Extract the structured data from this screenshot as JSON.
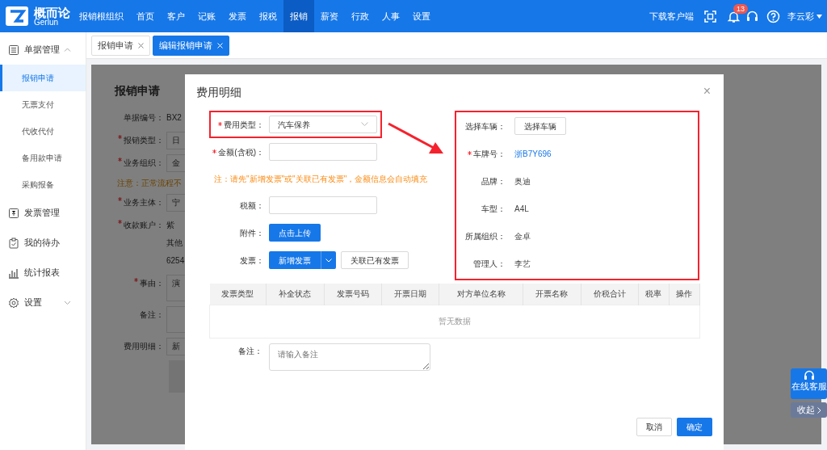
{
  "header": {
    "logo_text": "概而论",
    "logo_subtext": "Gerlun",
    "nav": [
      {
        "label": "报销根组织",
        "selected": false
      },
      {
        "label": "首页",
        "selected": false
      },
      {
        "label": "客户",
        "selected": false
      },
      {
        "label": "记账",
        "selected": false
      },
      {
        "label": "发票",
        "selected": false
      },
      {
        "label": "报税",
        "selected": false
      },
      {
        "label": "报销",
        "selected": true
      },
      {
        "label": "薪资",
        "selected": false
      },
      {
        "label": "行政",
        "selected": false
      },
      {
        "label": "人事",
        "selected": false
      },
      {
        "label": "设置",
        "selected": false
      }
    ],
    "download": "下载客户端",
    "notification_count": "13",
    "user": "李云彩"
  },
  "sidebar": {
    "items": [
      {
        "label": "单据管理",
        "expanded": true,
        "children": [
          {
            "label": "报销申请",
            "selected": true
          },
          {
            "label": "无票支付",
            "selected": false
          },
          {
            "label": "代收代付",
            "selected": false
          },
          {
            "label": "备用款申请",
            "selected": false
          },
          {
            "label": "采购报备",
            "selected": false
          }
        ]
      },
      {
        "label": "发票管理"
      },
      {
        "label": "我的待办"
      },
      {
        "label": "统计报表"
      },
      {
        "label": "设置",
        "expanded": false
      }
    ]
  },
  "tabs": [
    {
      "label": "报销申请",
      "selected": false
    },
    {
      "label": "编辑报销申请",
      "selected": true
    }
  ],
  "background_form": {
    "title": "报销申请",
    "fields": [
      {
        "kind": "text",
        "label": "单据编号：",
        "required": false,
        "values": [
          "BX2"
        ]
      },
      {
        "kind": "input",
        "label": "报销类型：",
        "required": true,
        "values": [
          "日"
        ]
      },
      {
        "kind": "input",
        "label": "业务组织：",
        "required": true,
        "values": [
          "金"
        ]
      },
      {
        "kind": "notice",
        "values": [
          "注意：正常流程不"
        ]
      },
      {
        "kind": "input",
        "label": "业务主体：",
        "required": true,
        "values": [
          "宁"
        ]
      },
      {
        "kind": "text",
        "label": "收款账户：",
        "required": true,
        "values": [
          "紫",
          "其他",
          "6254"
        ]
      },
      {
        "kind": "textarea",
        "label": "事由：",
        "required": true,
        "values": [
          "演"
        ]
      },
      {
        "kind": "textarea",
        "label": "备注：",
        "required": false
      },
      {
        "kind": "input",
        "label": "费用明细：",
        "required": false,
        "values": [
          "新"
        ]
      }
    ]
  },
  "modal": {
    "title": "费用明细",
    "close": "×",
    "fields": [
      {
        "kind": "select",
        "label": "费用类型：",
        "required": true,
        "highlighted": true,
        "value": "汽车保养"
      },
      {
        "kind": "input",
        "label": "金额(含税)：",
        "required": true,
        "highlighted": false
      },
      {
        "kind": "note",
        "text": "注：请先\"新增发票\"或\"关联已有发票\"，金额信息会自动填充"
      },
      {
        "kind": "input",
        "label": "税额：",
        "required": false,
        "highlighted": false
      },
      {
        "kind": "upload",
        "label": "附件：",
        "required": false,
        "highlighted": false,
        "value": "点击上传"
      },
      {
        "kind": "invoice",
        "label": "发票：",
        "required": false,
        "highlighted": false,
        "buttons": [
          "新增发票",
          "关联已有发票"
        ]
      }
    ],
    "vehicle": {
      "highlighted": true,
      "rows": [
        {
          "kind": "button",
          "label": "选择车辆：",
          "required": false,
          "value": "选择车辆"
        },
        {
          "kind": "link",
          "label": "车牌号：",
          "required": true,
          "value": "浙B7Y696"
        },
        {
          "kind": "text",
          "label": "品牌：",
          "required": false,
          "value": "奥迪"
        },
        {
          "kind": "text",
          "label": "车型：",
          "required": false,
          "value": "A4L"
        },
        {
          "kind": "text",
          "label": "所属组织：",
          "required": false,
          "value": "金卓"
        },
        {
          "kind": "text",
          "label": "管理人：",
          "required": false,
          "value": "李艺"
        }
      ]
    },
    "invoice_table": {
      "columns": [
        "发票类型",
        "补全状态",
        "发票号码",
        "开票日期",
        "对方单位名称",
        "开票名称",
        "价税合计",
        "税率",
        "操作"
      ],
      "empty_text": "暂无数据"
    },
    "remark": {
      "label": "备注：",
      "placeholder": "请输入备注"
    },
    "buttons": [
      {
        "label": "取消",
        "kind": "default"
      },
      {
        "label": "确定",
        "kind": "primary"
      }
    ]
  },
  "floating": {
    "support": "在线客服",
    "collapse": "收起"
  }
}
